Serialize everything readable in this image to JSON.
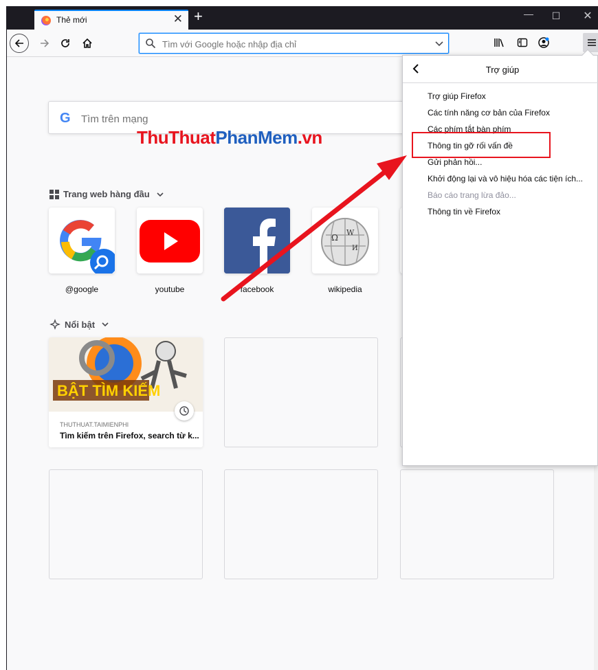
{
  "tab": {
    "title": "Thẻ mới",
    "close": "✕"
  },
  "window_controls": {
    "newtab": "+",
    "minimize": "—",
    "maximize": "☐",
    "close": "✕"
  },
  "urlbar": {
    "placeholder": "Tìm với Google hoặc nhập địa chỉ"
  },
  "newtab_page": {
    "search_placeholder": "Tìm trên mạng",
    "google_letter": "G",
    "watermark_part1": "ThuThuat",
    "watermark_part2": "PhanMem",
    "watermark_part3": ".vn",
    "topsites_heading": "Trang web hàng đầu",
    "topsites": [
      {
        "label": "@google",
        "icon": "google-icon"
      },
      {
        "label": "youtube",
        "icon": "youtube-icon"
      },
      {
        "label": "facebook",
        "icon": "facebook-icon"
      },
      {
        "label": "wikipedia",
        "icon": "wikipedia-icon"
      }
    ],
    "highlights_heading": "Nổi bật",
    "highlight_card": {
      "source": "THUTHUAT.TAIMIENPHI",
      "title": "Tìm kiếm trên Firefox, search từ k...",
      "image_text": "BẬT TÌM KIẾM"
    }
  },
  "help_panel": {
    "title": "Trợ giúp",
    "items": [
      {
        "label": "Trợ giúp Firefox",
        "disabled": false
      },
      {
        "label": "Các tính năng cơ bản của Firefox",
        "disabled": false
      },
      {
        "label": "Các phím tắt bàn phím",
        "disabled": false
      },
      {
        "label": "Thông tin gỡ rối vấn đề",
        "disabled": false
      },
      {
        "label": "Gửi phản hồi...",
        "disabled": false
      },
      {
        "label": "Khởi động lại và vô hiệu hóa các tiện ích...",
        "disabled": false
      },
      {
        "label": "Báo cáo trang lừa đảo...",
        "disabled": true
      },
      {
        "label": "Thông tin về Firefox",
        "disabled": false
      }
    ]
  },
  "colors": {
    "accent": "#0a84ff",
    "annotation_red": "#e8141e",
    "titlebar": "#1c1b22"
  }
}
